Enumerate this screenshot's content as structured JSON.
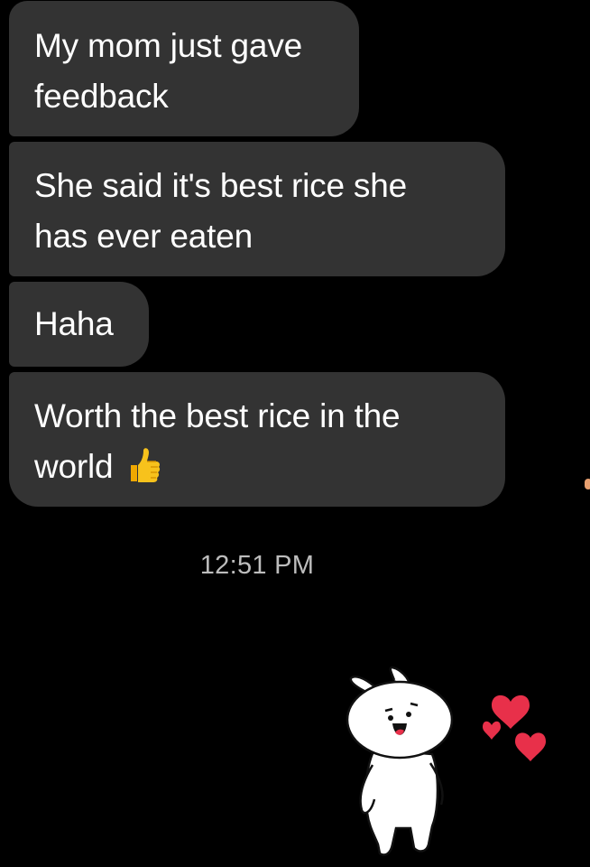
{
  "messages": [
    {
      "lines": [
        "My mom just gave",
        "feedback"
      ]
    },
    {
      "lines": [
        "She said it's best rice she",
        "has ever eaten"
      ]
    },
    {
      "lines": [
        "Haha"
      ]
    },
    {
      "lines": [
        "Worth the best rice in the",
        "world"
      ],
      "emoji": "thumbs-up-icon"
    }
  ],
  "timestamp": "12:51 PM",
  "sticker": {
    "name": "bunny-with-hearts-sticker"
  },
  "colors": {
    "background": "#000000",
    "bubble": "#333333",
    "text": "#ffffff",
    "timestamp": "#bdbdbd",
    "heart": "#e8304a"
  }
}
